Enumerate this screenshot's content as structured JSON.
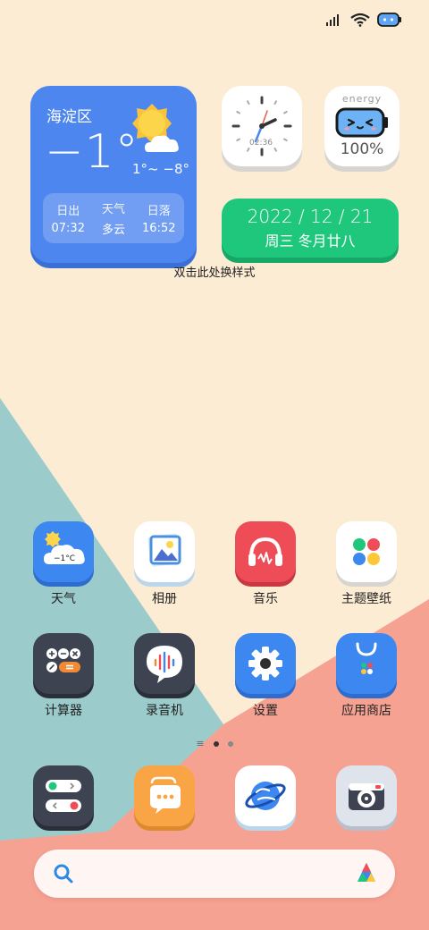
{
  "status": {
    "signal": "signal-icon",
    "wifi": "wifi-icon",
    "battery": "battery-face-icon"
  },
  "weather": {
    "city": "海淀区",
    "temp": "−1°",
    "range": "1°~ −8°",
    "sunrise_label": "日出",
    "sunrise": "07:32",
    "weather_label": "天气",
    "weather_value": "多云",
    "sunset_label": "日落",
    "sunset": "16:52"
  },
  "clock": {
    "time": "02:36"
  },
  "battery": {
    "label": "energy",
    "percent": "100%"
  },
  "date": {
    "line1": "2022 / 12 / 21",
    "line2": "周三 冬月廿八"
  },
  "hint": "双击此处换样式",
  "apps": {
    "weather": {
      "label": "天气",
      "badge": "−1°C"
    },
    "album": {
      "label": "相册"
    },
    "music": {
      "label": "音乐"
    },
    "themes": {
      "label": "主题壁纸"
    },
    "calculator": {
      "label": "计算器"
    },
    "recorder": {
      "label": "录音机"
    },
    "settings": {
      "label": "设置"
    },
    "appstore": {
      "label": "应用商店"
    }
  },
  "colors": {
    "background": "#fcecd4",
    "teal": "#9ccbcb",
    "coral": "#f6a292",
    "weather_widget": "#4e86f0",
    "date_widget": "#1fc77c"
  }
}
